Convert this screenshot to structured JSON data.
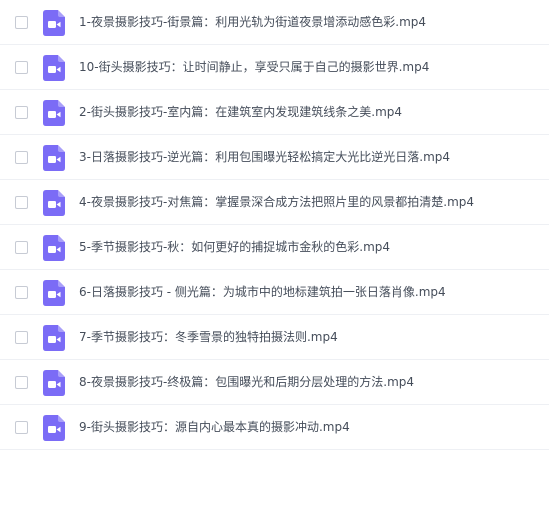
{
  "colors": {
    "icon_purple": "#7b6cf6",
    "text": "#454d5a",
    "divider": "#eef0f4",
    "checkbox_border": "#c7cbd4"
  },
  "icons": {
    "file_type": "video-file-icon"
  },
  "files": [
    {
      "name": "1-夜景摄影技巧-街景篇：利用光轨为街道夜景增添动感色彩.mp4"
    },
    {
      "name": "10-街头摄影技巧：让时间静止，享受只属于自己的摄影世界.mp4"
    },
    {
      "name": "2-街头摄影技巧-室内篇：在建筑室内发现建筑线条之美.mp4"
    },
    {
      "name": "3-日落摄影技巧-逆光篇：利用包围曝光轻松搞定大光比逆光日落.mp4"
    },
    {
      "name": "4-夜景摄影技巧-对焦篇：掌握景深合成方法把照片里的风景都拍清楚.mp4"
    },
    {
      "name": "5-季节摄影技巧-秋：如何更好的捕捉城市金秋的色彩.mp4"
    },
    {
      "name": "6-日落摄影技巧 - 侧光篇：为城市中的地标建筑拍一张日落肖像.mp4"
    },
    {
      "name": "7-季节摄影技巧：冬季雪景的独特拍摄法则.mp4"
    },
    {
      "name": "8-夜景摄影技巧-终极篇：包围曝光和后期分层处理的方法.mp4"
    },
    {
      "name": "9-街头摄影技巧：源自内心最本真的摄影冲动.mp4"
    }
  ]
}
